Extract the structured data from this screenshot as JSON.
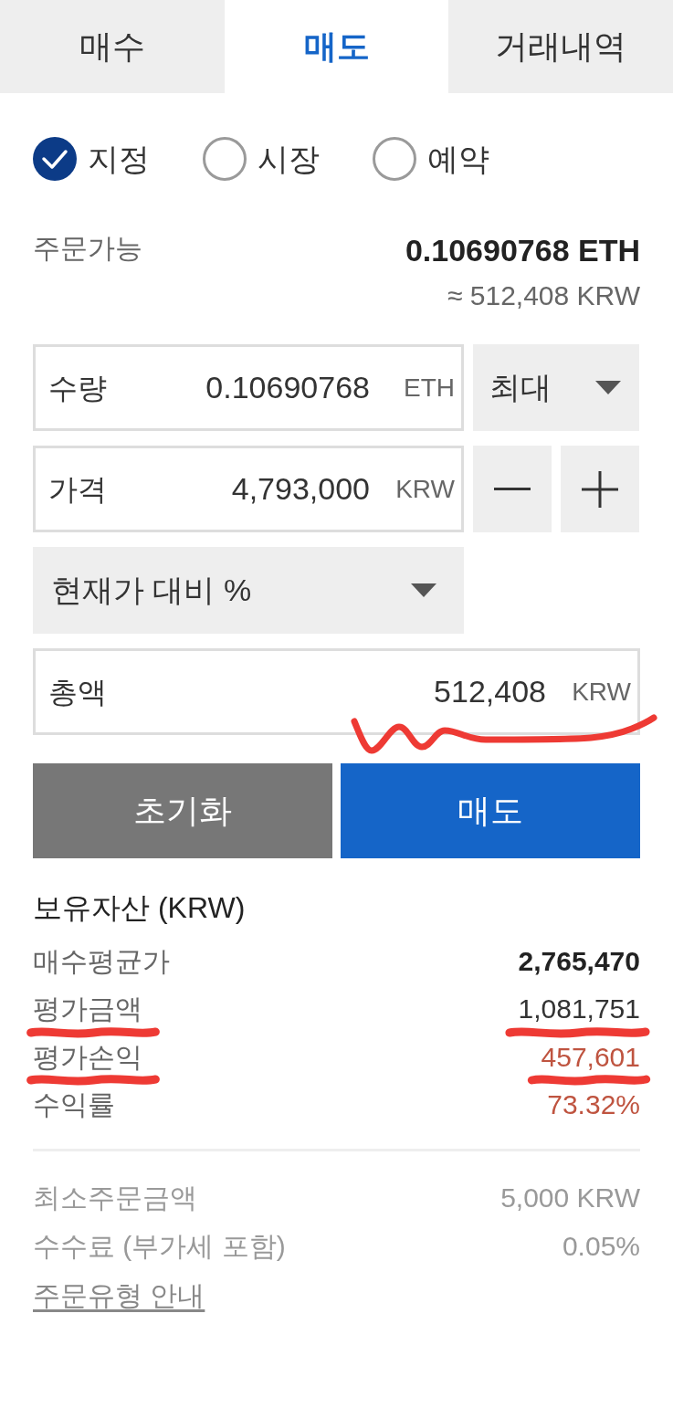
{
  "tabs": [
    {
      "label": "매수",
      "selected": false
    },
    {
      "label": "매도",
      "selected": true
    },
    {
      "label": "거래내역",
      "selected": false
    }
  ],
  "order_types": [
    {
      "label": "지정",
      "selected": true
    },
    {
      "label": "시장",
      "selected": false
    },
    {
      "label": "예약",
      "selected": false
    }
  ],
  "available": {
    "label": "주문가능",
    "value": "0.10690768 ETH",
    "approx": "≈ 512,408 KRW"
  },
  "quantity": {
    "label": "수량",
    "value": "0.10690768",
    "unit": "ETH",
    "dropdown": "최대"
  },
  "price": {
    "label": "가격",
    "value": "4,793,000",
    "unit": "KRW"
  },
  "percent_dropdown": {
    "label": "현재가 대비 %"
  },
  "total": {
    "label": "총액",
    "value": "512,408",
    "unit": "KRW",
    "scribble": true
  },
  "buttons": [
    {
      "label": "초기화",
      "kind": "reset"
    },
    {
      "label": "매도",
      "kind": "submit"
    }
  ],
  "holdings": {
    "title": "보유자산 (KRW)",
    "rows": [
      {
        "label": "매수평균가",
        "value": "2,765,470",
        "kind": "bold",
        "scribble": false
      },
      {
        "label": "평가금액",
        "value": "1,081,751",
        "kind": "normal",
        "scribble": true
      },
      {
        "label": "평가손익",
        "value": "457,601",
        "kind": "gain",
        "scribble": true
      },
      {
        "label": "수익률",
        "value": "73.32%",
        "kind": "gain",
        "scribble": false
      }
    ]
  },
  "info": {
    "rows": [
      {
        "label": "최소주문금액",
        "value": "5,000 KRW"
      },
      {
        "label": "수수료 (부가세 포함)",
        "value": "0.05%"
      }
    ],
    "link": "주문유형 안내"
  }
}
